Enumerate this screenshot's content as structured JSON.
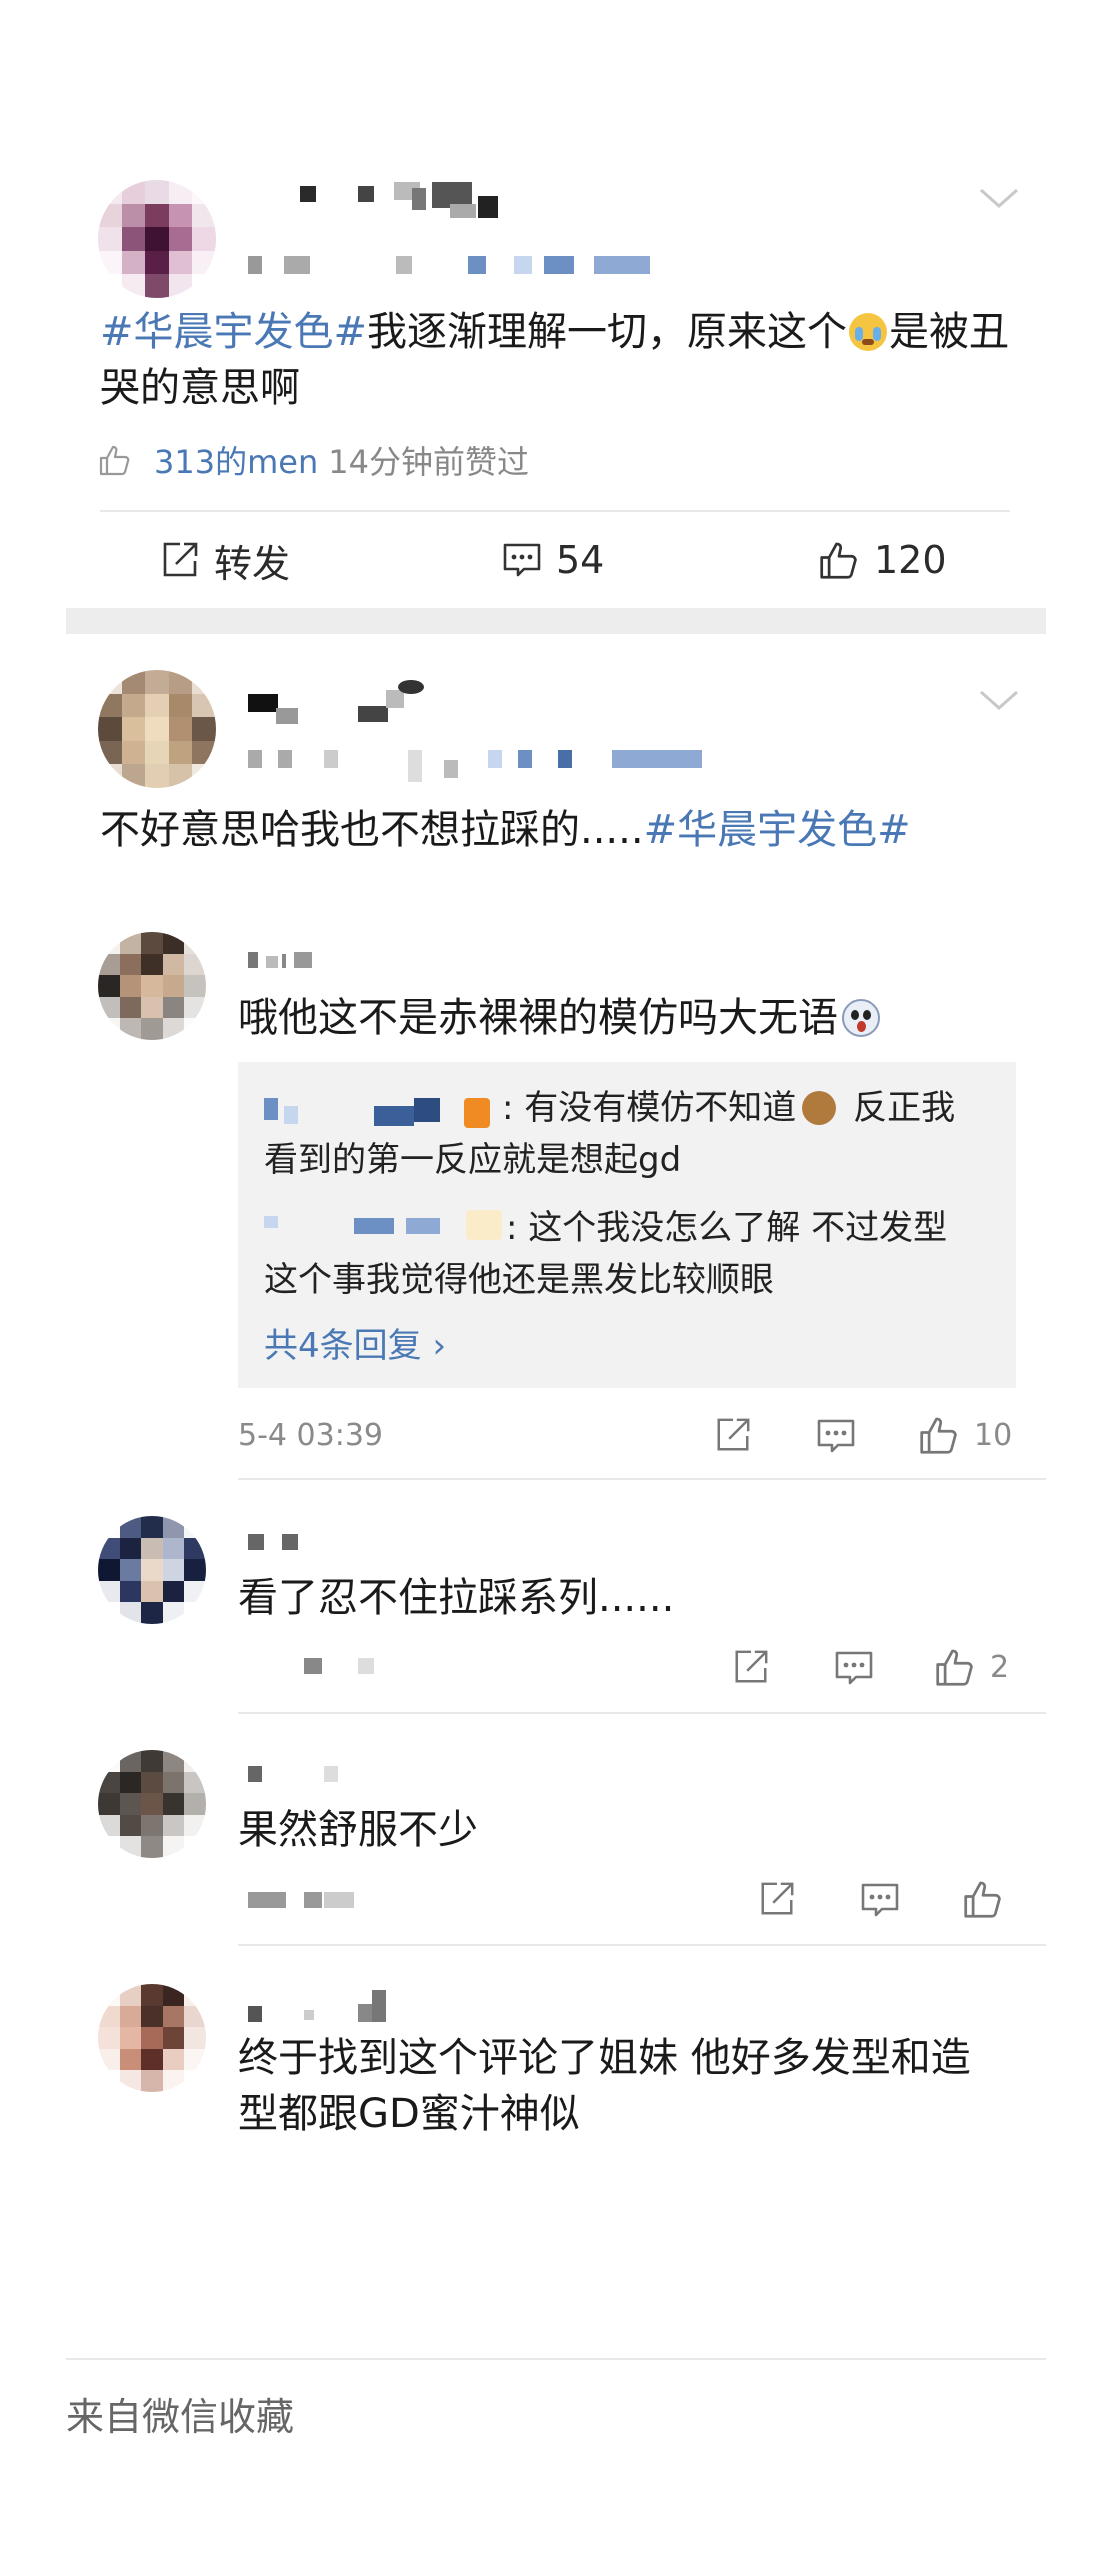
{
  "post1": {
    "text_topic1": "#华晨宇发色#",
    "text_body": "我逐渐理解一切，原来这个",
    "text_body2": "是被丑",
    "text_body3": "哭的意思啊",
    "liked_by_name": "313的men",
    "liked_by_suffix": "14分钟前赞过",
    "actions": {
      "repost": "转发",
      "comments": "54",
      "likes": "120"
    }
  },
  "post2": {
    "text_plain": "不好意思哈我也不想拉踩的.....",
    "text_topic": "#华晨宇发色#"
  },
  "comments": [
    {
      "text": "哦他这不是赤裸裸的模仿吗大无语",
      "replies": [
        {
          "text1": ": 有没有模仿不知道",
          "text2": " 反正我",
          "text3": "看到的第一反应就是想起gd"
        },
        {
          "text1": ": 这个我没怎么了解  不过发型",
          "text3": "这个事我觉得他还是黑发比较顺眼"
        }
      ],
      "more_replies": "共4条回复 ›",
      "time": "5-4 03:39",
      "likes": "10"
    },
    {
      "text": "看了忍不住拉踩系列......",
      "likes": "2"
    },
    {
      "text": "果然舒服不少",
      "likes": ""
    },
    {
      "text1": "终于找到这个评论了姐妹   他好多发型和造",
      "text2": "型都跟GD蜜汁神似"
    }
  ],
  "footer": {
    "source": "来自微信收藏"
  }
}
